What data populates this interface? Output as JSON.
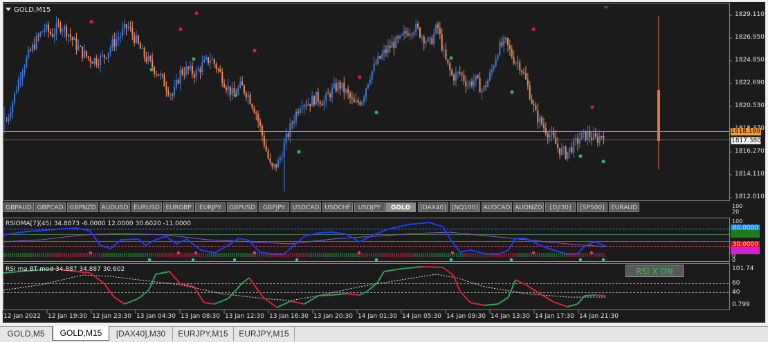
{
  "window": {
    "title": "GOLD,M15"
  },
  "price_axis": {
    "ticks": [
      "1829.110",
      "1826.950",
      "1824.850",
      "1822.690",
      "1820.530",
      "1818.370",
      "1816.270",
      "1814.110",
      "1812.010"
    ],
    "current_label": "1818.180",
    "bid_label": "1817.380"
  },
  "symbol_buttons": [
    "GBPAUD",
    "GBPCAD",
    "GBPNZD",
    "AUDUSD",
    "EURUSD",
    "EURGBP",
    "EURJPY",
    "GBPUSD",
    "GBPJPY",
    "USDCAD",
    "USDCHF",
    "USDJPY",
    "GOLD",
    "[DAX40]",
    "[NQ100]",
    "AUDCAD",
    "AUDNZD",
    "[DJI30]",
    "[SP500]",
    "EURAUD"
  ],
  "active_symbol": "GOLD",
  "rsioma": {
    "label": "RSIOMA[7](45) 34.8873 -6.0000 12.0000 30.6020 -11.0000",
    "axis": [
      "100",
      "20",
      "100",
      "80",
      "0",
      "0",
      "20"
    ],
    "box_values": [
      "80.0000",
      "30.0000"
    ]
  },
  "rsi_bt": {
    "label": "RSI ma BT mod 34.887 34.887 30.602",
    "axis": [
      "101.74",
      "60",
      "40",
      "0.799"
    ],
    "button": "RSI X ON"
  },
  "time_axis": [
    "12 Jan 2022",
    "12 Jan 19:30",
    "12 Jan 23:30",
    "13 Jan 04:30",
    "13 Jan 08:30",
    "13 Jan 12:30",
    "13 Jan 16:30",
    "13 Jan 20:30",
    "14 Jan 01:30",
    "14 Jan 05:30",
    "14 Jan 09:30",
    "14 Jan 13:30",
    "14 Jan 17:30",
    "14 Jan 21:30"
  ],
  "tabs": [
    "GOLD,M5",
    "GOLD,M15",
    "[DAX40],M30",
    "EURJPY,M15",
    "EURJPY,M15"
  ],
  "active_tab": "GOLD,M15",
  "chart_data": {
    "type": "candlestick",
    "symbol": "GOLD",
    "timeframe": "M15",
    "current_price": 1818.18,
    "bid_price": 1817.38,
    "close_path": [
      1819.2,
      1821.5,
      1824.0,
      1825.5,
      1826.8,
      1827.9,
      1827.3,
      1828.2,
      1827.6,
      1826.5,
      1825.6,
      1825.0,
      1824.9,
      1825.3,
      1826.4,
      1827.2,
      1828.1,
      1826.9,
      1825.5,
      1824.6,
      1823.7,
      1822.6,
      1821.5,
      1823.8,
      1824.0,
      1823.6,
      1824.5,
      1825.1,
      1824.0,
      1822.6,
      1821.6,
      1822.5,
      1821.6,
      1820.0,
      1817.4,
      1814.6,
      1815.3,
      1817.5,
      1819.5,
      1821.0,
      1820.9,
      1821.4,
      1821.0,
      1822.0,
      1822.6,
      1821.8,
      1820.7,
      1821.2,
      1823.4,
      1824.7,
      1825.6,
      1826.4,
      1826.7,
      1827.6,
      1828.0,
      1827.2,
      1826.4,
      1828.1,
      1825.0,
      1823.3,
      1823.7,
      1822.6,
      1823.1,
      1822.0,
      1823.5,
      1825.9,
      1826.6,
      1825.1,
      1824.4,
      1822.3,
      1819.8,
      1818.7,
      1817.8,
      1816.6,
      1816.1,
      1816.9,
      1817.7,
      1817.9,
      1817.4,
      1818.1
    ]
  }
}
